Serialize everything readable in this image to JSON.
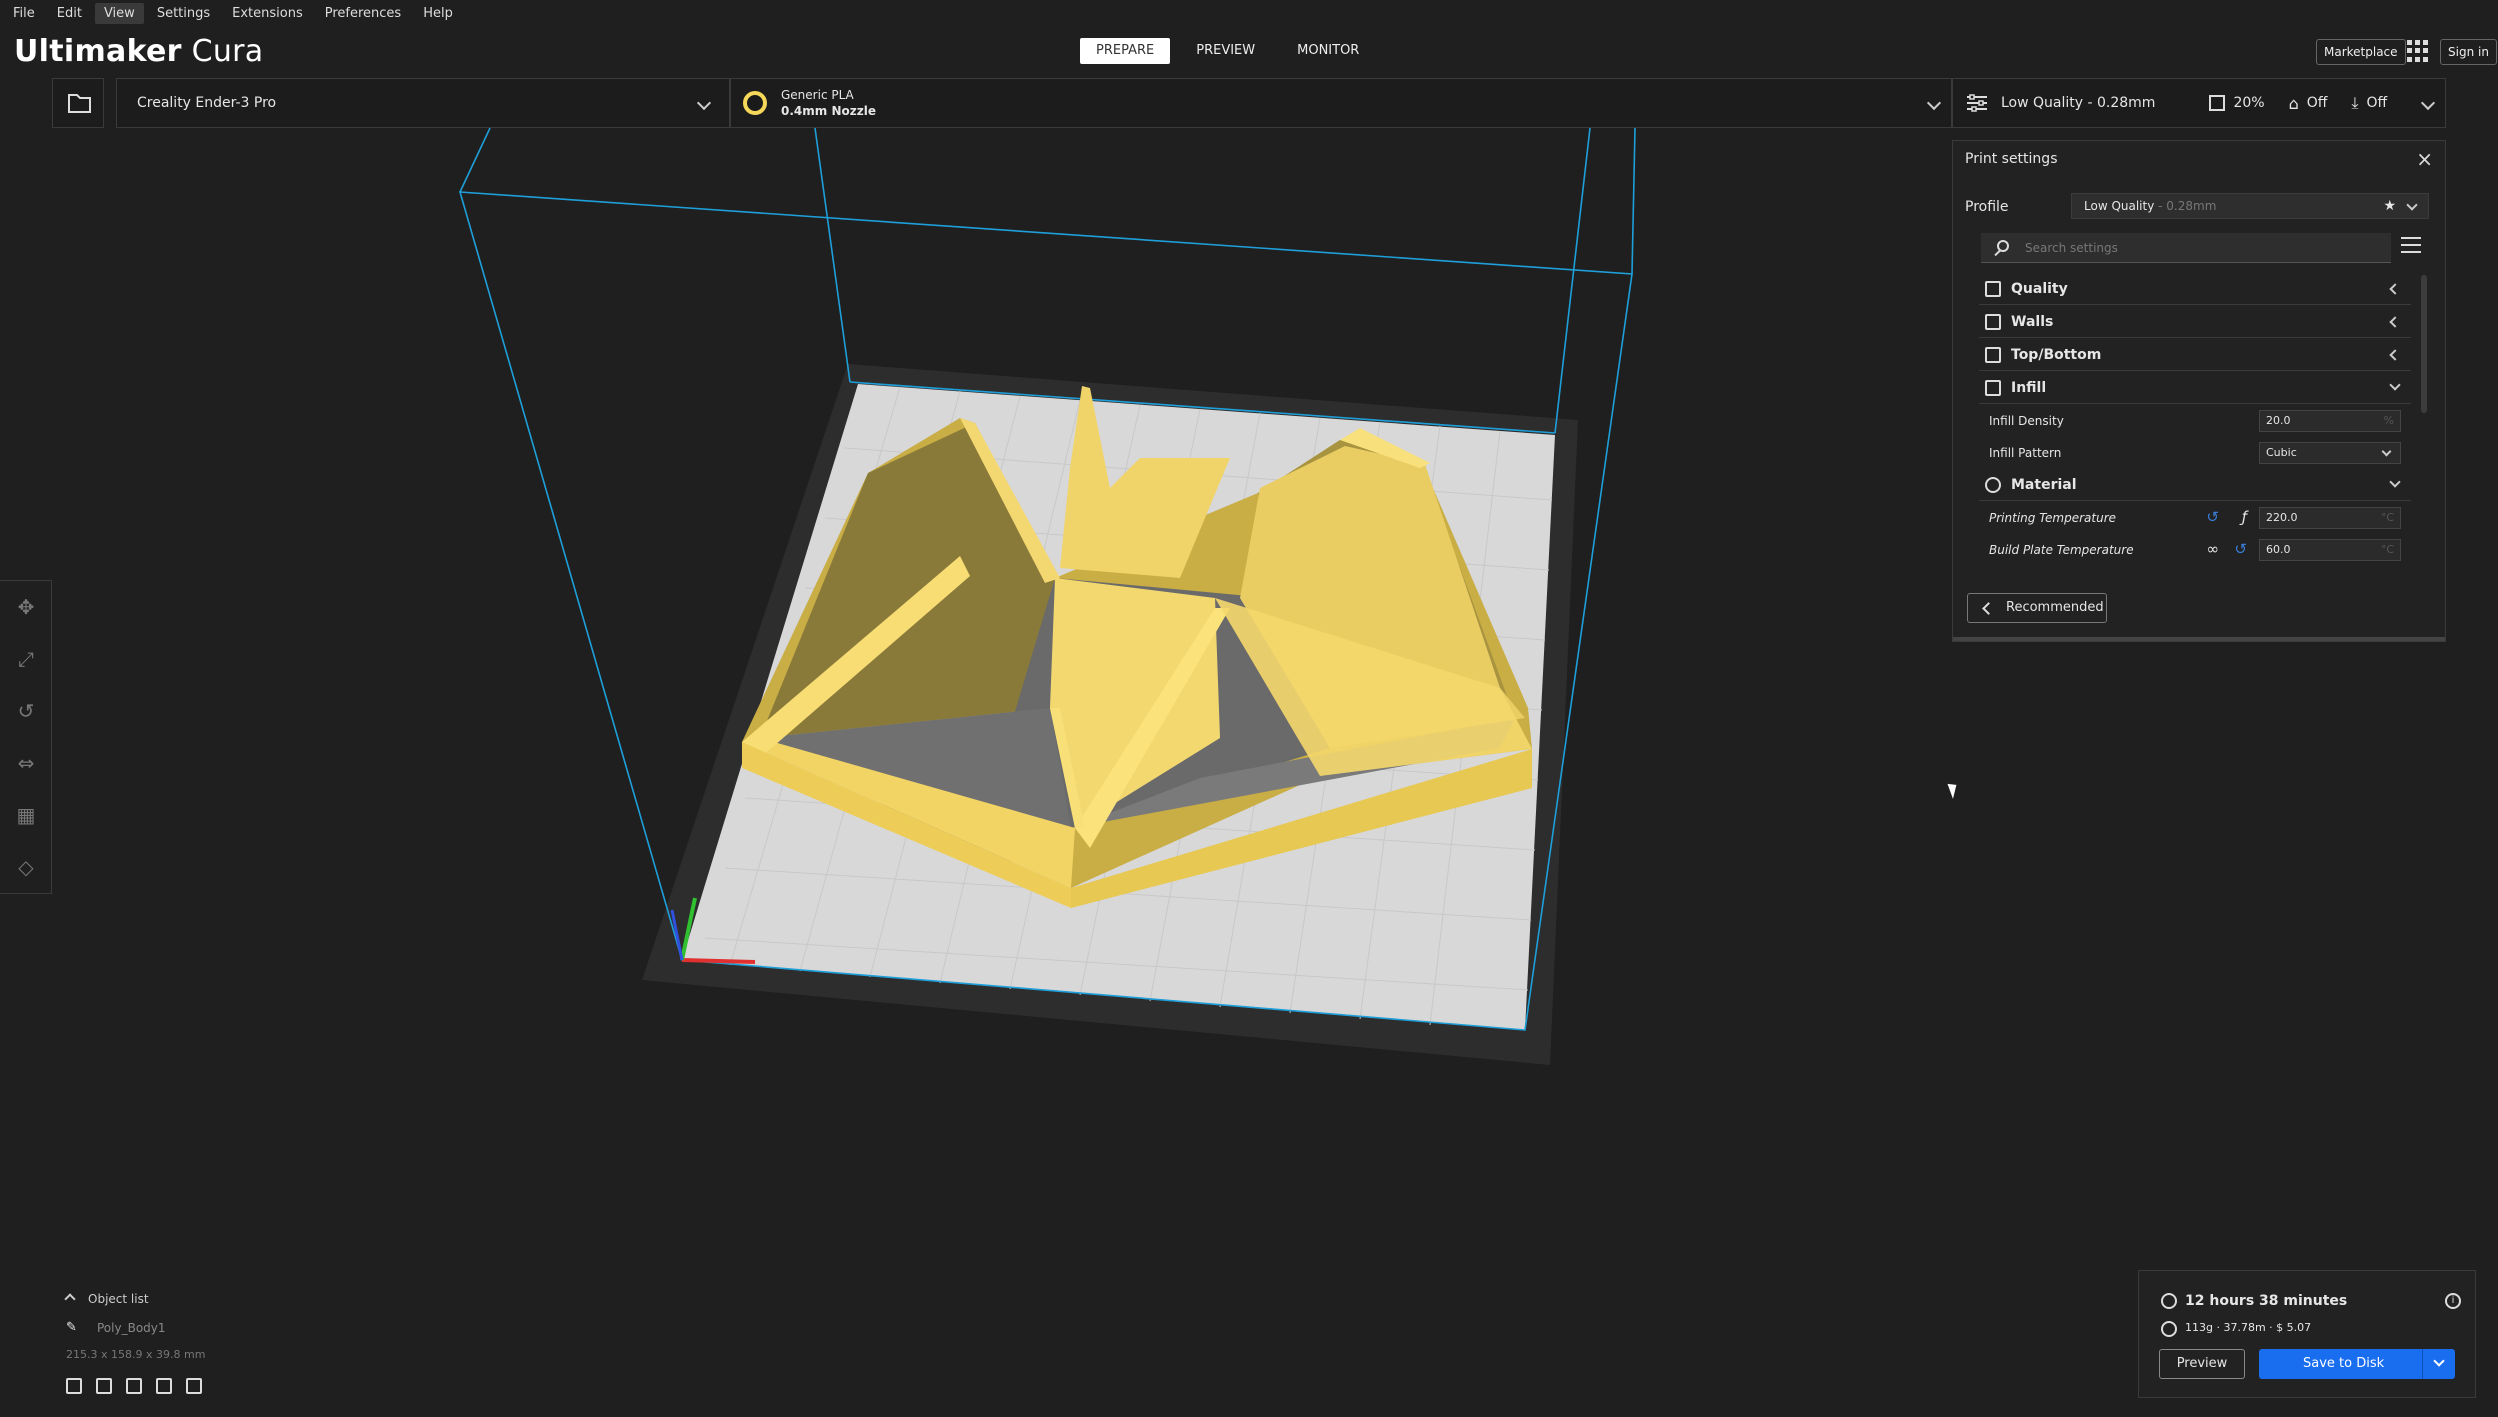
{
  "menu": [
    "File",
    "Edit",
    "View",
    "Settings",
    "Extensions",
    "Preferences",
    "Help"
  ],
  "brand": {
    "bold": "Ultimaker",
    "light": "Cura"
  },
  "stages": [
    "PREPARE",
    "PREVIEW",
    "MONITOR"
  ],
  "header": {
    "marketplace": "Marketplace",
    "signin": "Sign in"
  },
  "printer": {
    "name": "Creality Ender-3 Pro"
  },
  "material": {
    "name": "Generic PLA",
    "nozzle": "0.4mm Nozzle",
    "extruder": "1",
    "color": "#f5d75a"
  },
  "print_summary": {
    "profile": "Low Quality - 0.28mm",
    "infill": "20%",
    "support": "Off",
    "adhesion": "Off"
  },
  "panel": {
    "title": "Print settings",
    "profile_label": "Profile",
    "profile_value": "Low Quality",
    "profile_suffix": " - 0.28mm",
    "search_placeholder": "Search settings",
    "categories": {
      "quality": "Quality",
      "walls": "Walls",
      "topbottom": "Top/Bottom",
      "infill": "Infill",
      "material": "Material"
    },
    "settings": {
      "infill_density": {
        "label": "Infill Density",
        "value": "20.0",
        "unit": "%"
      },
      "infill_pattern": {
        "label": "Infill Pattern",
        "value": "Cubic"
      },
      "print_temp": {
        "label": "Printing Temperature",
        "value": "220.0",
        "unit": "°C"
      },
      "bed_temp": {
        "label": "Build Plate Temperature",
        "value": "60.0",
        "unit": "°C"
      }
    },
    "recommended": "Recommended"
  },
  "objects": {
    "title": "Object list",
    "name": "Poly_Body1",
    "dims": "215.3 x 158.9 x 39.8 mm"
  },
  "estimate": {
    "time": "12 hours 38 minutes",
    "material": "113g · 37.78m · $ 5.07",
    "preview": "Preview",
    "save": "Save to Disk"
  },
  "colors": {
    "accent": "#196ef0",
    "model": "#f5d75a",
    "buildbox": "#1e9fd9"
  }
}
